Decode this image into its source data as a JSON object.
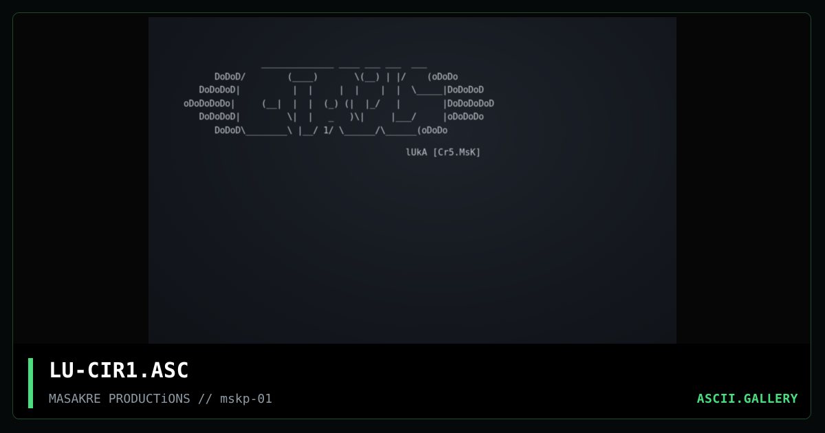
{
  "preview": {
    "ascii_art": "                 ______________ ____ ___ ___  ___\n        DoDoD/        (____)       \\(__) | |/    (oDoDo\n     DoDoDoD|          |  |     |  |    |  |  \\_____|DoDoDoD\n  oDoDoDoDo|     (__|  |  |  (_) (|  |_/   |        |DoDoDoDoD\n     DoDoDoD|         \\|  |   _   )\\|     |___/     |oDoDoDo\n        DoDoD\\________\\ |__/ 1/ \\______/\\______(oDoDo",
    "credit": "lUkA [Cr5.MsK]"
  },
  "footer": {
    "title": "LU-CIR1.ASC",
    "subtitle": "MASAKRE PRODUCTiONS // mskp-01",
    "brand": "ASCII.GALLERY"
  },
  "colors": {
    "accent": "#4ade80",
    "card_border": "#1f4a2a",
    "preview_bg": "#1a1e25",
    "ascii_fg": "#c4c8cf",
    "subtitle_fg": "#8e9aa4"
  }
}
